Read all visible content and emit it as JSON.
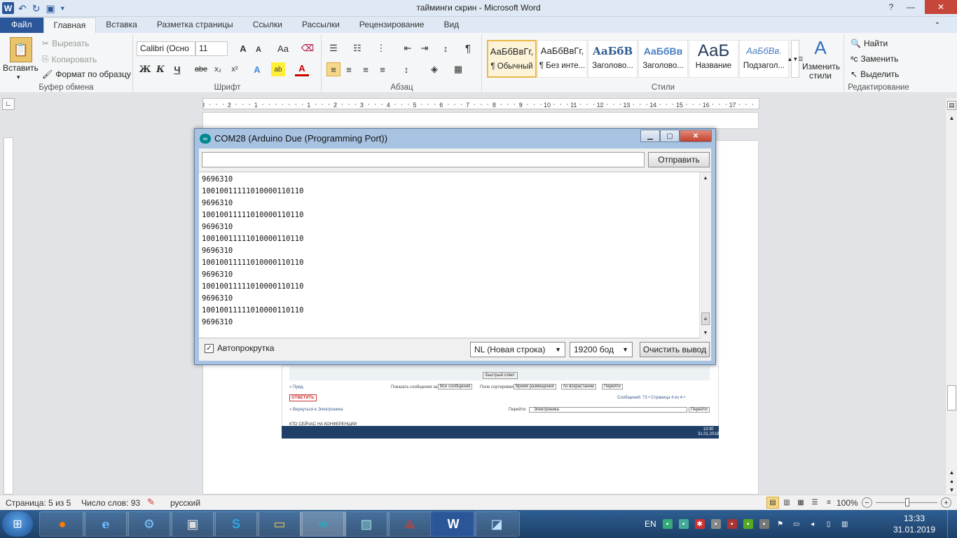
{
  "window": {
    "title": "тайминги скрин  -  Microsoft Word",
    "app_letter": "W"
  },
  "ribbon_tabs": [
    "Файл",
    "Главная",
    "Вставка",
    "Разметка страницы",
    "Ссылки",
    "Рассылки",
    "Рецензирование",
    "Вид"
  ],
  "clipboard": {
    "paste": "Вставить",
    "cut": "Вырезать",
    "copy": "Копировать",
    "format_painter": "Формат по образцу",
    "label": "Буфер обмена"
  },
  "font": {
    "name": "Calibri (Осно",
    "size": "11",
    "label": "Шрифт",
    "bold": "Ж",
    "italic": "К",
    "underline": "Ч",
    "strike": "abe",
    "grow": "A",
    "shrink": "A",
    "case": "Aa"
  },
  "paragraph": {
    "label": "Абзац"
  },
  "styles": {
    "label": "Стили",
    "items": [
      {
        "preview": "АаБбВвГг,",
        "name": "¶ Обычный"
      },
      {
        "preview": "АаБбВвГг,",
        "name": "¶ Без инте..."
      },
      {
        "preview": "АаБбВ",
        "name": "Заголово..."
      },
      {
        "preview": "АаБбВв",
        "name": "Заголово..."
      },
      {
        "preview": "АаБ",
        "name": "Название"
      },
      {
        "preview": "АаБбВв.",
        "name": "Подзагол..."
      }
    ],
    "change": "Изменить стили"
  },
  "editing": {
    "find": "Найти",
    "replace": "Заменить",
    "select": "Выделить",
    "label": "Редактирование"
  },
  "ruler": {
    "numbers": [
      "3",
      "2",
      "1",
      "1",
      "2",
      "3",
      "4",
      "5",
      "6",
      "7",
      "8",
      "9",
      "10",
      "11",
      "12",
      "13",
      "14",
      "15",
      "16",
      "17"
    ]
  },
  "serial_monitor": {
    "title": "COM28 (Arduino Due (Programming Port))",
    "input_value": "",
    "send": "Отправить",
    "lines": [
      "9696310",
      "10010011111010000110110",
      "9696310",
      "10010011111010000110110",
      "9696310",
      "10010011111010000110110",
      "9696310",
      "10010011111010000110110",
      "9696310",
      "10010011111010000110110",
      "9696310",
      "10010011111010000110110",
      "9696310"
    ],
    "autoscroll": "Автопрокрутка",
    "line_ending": "NL (Новая строка)",
    "baud": "19200 бод",
    "clear": "Очистить вывод"
  },
  "embedded": {
    "quick_reply": "Быстрый ответ",
    "prev": "« Пред.",
    "show_messages": "Показать сообщения за:",
    "all_messages": "Все сообщения",
    "sort_by": "Поле сортировки",
    "sort_field": "Время размещения",
    "order": "по возрастанию",
    "go": "Перейти",
    "reply": "ОТВЕТИТЬ",
    "messages_count": "Сообщений: 73 • Страница 4 из 4 •",
    "back": "« Вернуться в Электроника",
    "jump": "Перейти:",
    "forum": "Электроника",
    "who_online": "КТО СЕЙЧАС НА КОНФЕРЕНЦИИ",
    "tray_time": "13:30",
    "tray_date": "31.01.2019"
  },
  "status_bar": {
    "page": "Страница: 5 из 5",
    "words": "Число слов: 93",
    "language": "русский",
    "zoom": "100%"
  },
  "taskbar": {
    "lang": "EN",
    "time": "13:33",
    "date": "31.01.2019"
  },
  "colors": {
    "word_blue": "#2b579a",
    "arduino_teal": "#00878f",
    "taskbar": "#1d3f66"
  }
}
